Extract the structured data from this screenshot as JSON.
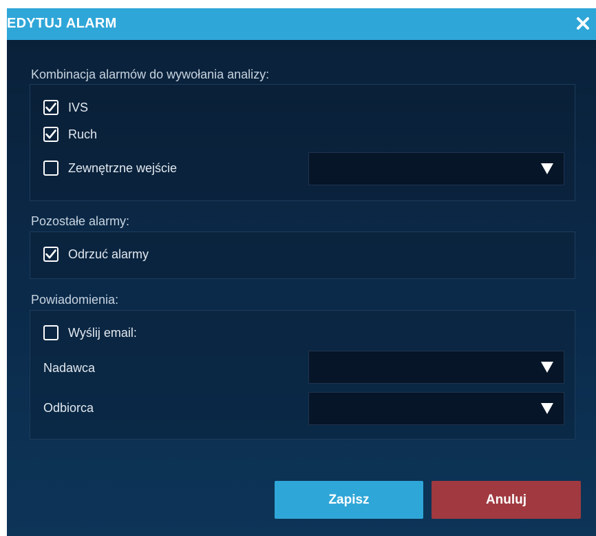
{
  "dialog": {
    "title": "EDYTUJ ALARM",
    "close_icon": "close-icon"
  },
  "alarm_combination": {
    "label": "Kombinacja alarmów do wywołania analizy:",
    "items": [
      {
        "label": "IVS",
        "checked": true
      },
      {
        "label": "Ruch",
        "checked": true
      },
      {
        "label": "Zewnętrzne wejście",
        "checked": false
      }
    ],
    "input_select_value": ""
  },
  "other_alarms": {
    "label": "Pozostałe alarmy:",
    "items": [
      {
        "label": "Odrzuć alarmy",
        "checked": true
      }
    ]
  },
  "notifications": {
    "label": "Powiadomienia:",
    "send_email": {
      "label": "Wyślij email:",
      "checked": false
    },
    "sender_label": "Nadawca",
    "sender_value": "",
    "recipient_label": "Odbiorca",
    "recipient_value": ""
  },
  "buttons": {
    "save": "Zapisz",
    "cancel": "Anuluj"
  },
  "colors": {
    "titlebar": "#2fa6d8",
    "save_button": "#2fa6d8",
    "cancel_button": "#a03a40",
    "background": "#0b2a4a"
  }
}
